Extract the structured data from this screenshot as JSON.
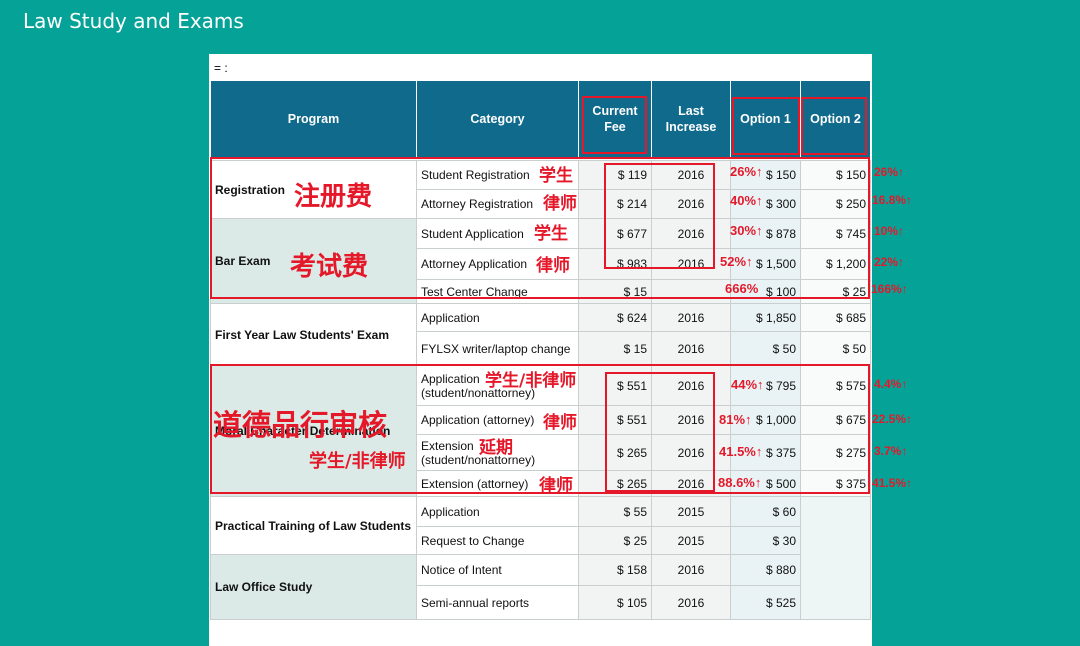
{
  "header": {
    "title": "Law Study and Exams"
  },
  "doc": {
    "marker": "= :"
  },
  "columns": [
    "Program",
    "Category",
    "Current Fee",
    "Last Increase",
    "Option 1",
    "Option 2"
  ],
  "rows": [
    {
      "program": "Registration",
      "category": "Student Registration",
      "fee": "$ 119",
      "year": "2016",
      "opt1": "$ 150",
      "opt2": "$ 150"
    },
    {
      "program": "",
      "category": "Attorney Registration",
      "fee": "$ 214",
      "year": "2016",
      "opt1": "$ 300",
      "opt2": "$ 250"
    },
    {
      "program": "Bar Exam",
      "category": "Student Application",
      "fee": "$ 677",
      "year": "2016",
      "opt1": "$ 878",
      "opt2": "$ 745"
    },
    {
      "program": "",
      "category": "Attorney Application",
      "fee": "$ 983",
      "year": "2016",
      "opt1": "$ 1,500",
      "opt2": "$ 1,200"
    },
    {
      "program": "",
      "category": "Test Center Change",
      "fee": "$ 15",
      "year": "",
      "opt1": "$ 100",
      "opt2": "$ 25"
    },
    {
      "program": "First Year Law Students' Exam",
      "category": "Application",
      "fee": "$ 624",
      "year": "2016",
      "opt1": "$ 1,850",
      "opt2": "$ 685"
    },
    {
      "program": "",
      "category": "FYLSX writer/laptop change",
      "fee": "$ 15",
      "year": "2016",
      "opt1": "$ 50",
      "opt2": "$ 50"
    },
    {
      "program": "Moral Character Determination",
      "category": "Application (student/nonattorney)",
      "fee": "$ 551",
      "year": "2016",
      "opt1": "$ 795",
      "opt2": "$ 575"
    },
    {
      "program": "",
      "category": "Application (attorney)",
      "fee": "$ 551",
      "year": "2016",
      "opt1": "$ 1,000",
      "opt2": "$ 675"
    },
    {
      "program": "",
      "category": "Extension (student/nonattorney)",
      "fee": "$ 265",
      "year": "2016",
      "opt1": "$ 375",
      "opt2": "$ 275"
    },
    {
      "program": "",
      "category": "Extension (attorney)",
      "fee": "$ 265",
      "year": "2016",
      "opt1": "$ 500",
      "opt2": "$ 375"
    },
    {
      "program": "Practical Training of Law Students",
      "category": "Application",
      "fee": "$ 55",
      "year": "2015",
      "opt1": "$ 60",
      "opt2": ""
    },
    {
      "program": "",
      "category": "Request to Change",
      "fee": "$ 25",
      "year": "2015",
      "opt1": "$ 30",
      "opt2": ""
    },
    {
      "program": "Law Office Study",
      "category": "Notice of Intent",
      "fee": "$ 158",
      "year": "2016",
      "opt1": "$ 880",
      "opt2": ""
    },
    {
      "program": "",
      "category": "Semi-annual reports",
      "fee": "$ 105",
      "year": "2016",
      "opt1": "$ 525",
      "opt2": ""
    }
  ],
  "annotations": {
    "group_registration": "注册费",
    "group_exam": "考试费",
    "group_moral": "道德品行审核",
    "moral_sub": "学生/非律师",
    "cat_student_reg": "学生",
    "cat_attorney_reg": "律师",
    "cat_student_app": "学生",
    "cat_attorney_app": "律师",
    "cat_moral_app_student": "学生/非律师",
    "cat_moral_app_attorney": "律师",
    "cat_extension_student": "延期",
    "cat_extension_attorney": "律师",
    "opt1_pct": [
      "26%↑",
      "40%↑",
      "30%↑",
      "52%↑",
      "666%",
      "44%↑",
      "81%↑",
      "41.5%↑",
      "88.6%↑"
    ],
    "opt2_pct": [
      "26%↑",
      "16.8%↑",
      "10%↑",
      "22%↑",
      "166%↑",
      "4.4%↑",
      "22.5%↑",
      "3.7%↑",
      "41.5%↑"
    ]
  },
  "colors": {
    "background": "#05a397",
    "header": "#0f6a8c",
    "highlight": "#e5182a"
  }
}
